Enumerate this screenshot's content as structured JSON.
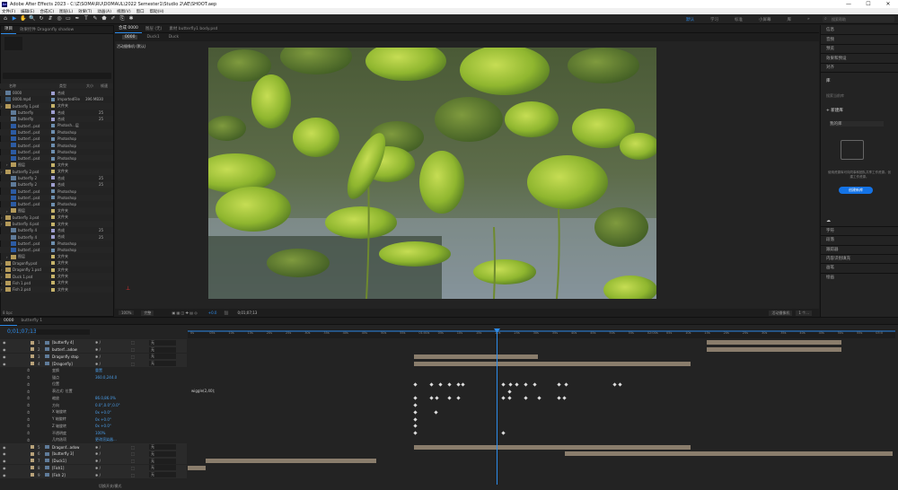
{
  "titlebar": {
    "logo": "Ae",
    "title": "Adobe After Effects 2023 - C:\\Z\\SOMA\\RU\\DOMAUL\\2022 Semester1\\Studio 2\\AE\\SHOOT.aep",
    "min": "—",
    "max": "☐",
    "close": "✕"
  },
  "menu": [
    "文件(F)",
    "编辑(E)",
    "合成(C)",
    "图层(L)",
    "效果(T)",
    "动画(A)",
    "视图(V)",
    "窗口",
    "帮助(H)"
  ],
  "tools": [
    "⌂",
    "▶",
    "✋",
    "🔍",
    "↻",
    "⇵",
    "◎",
    "▭",
    "✒",
    "T",
    "✎",
    "⬟",
    "✐",
    "⎘",
    "✱"
  ],
  "workspaces": {
    "items": [
      "默认",
      "学习",
      "标准",
      "小屏幕",
      "库"
    ],
    "active": 0,
    "more": "»"
  },
  "search_placeholder": "搜索帮助",
  "project": {
    "tabs": [
      "项目",
      "效果控件 Dragonfly shadow"
    ],
    "head": {
      "name": "名称",
      "type": "类型",
      "size": "大小",
      "fr": "帧速"
    },
    "rows": [
      {
        "name": "0000",
        "type": "合成",
        "sz": "",
        "fr": "",
        "k": "comp",
        "c": "#9e9ecf",
        "i": 0
      },
      {
        "name": "0000.mp4",
        "type": "ImportedFile",
        "sz": "396 MB",
        "fr": "30",
        "k": "file",
        "c": "#6d8eae",
        "i": 0
      },
      {
        "name": "butterfly 1.psd",
        "type": "文件夹",
        "sz": "",
        "fr": "",
        "k": "folder",
        "c": "#c5b26a",
        "i": 0
      },
      {
        "name": "butterfly",
        "type": "合成",
        "sz": "",
        "fr": "25",
        "k": "comp",
        "c": "#9e9ecf",
        "i": 1
      },
      {
        "name": "butterfly",
        "type": "合成",
        "sz": "",
        "fr": "25",
        "k": "comp",
        "c": "#9e9ecf",
        "i": 1
      },
      {
        "name": "butterf...psd",
        "type": "Photosh...层",
        "sz": "",
        "fr": "",
        "k": "psd",
        "c": "#6d8eae",
        "i": 1
      },
      {
        "name": "butterf...psd",
        "type": "Photoshop",
        "sz": "",
        "fr": "",
        "k": "psd",
        "c": "#6d8eae",
        "i": 1
      },
      {
        "name": "butterf...psd",
        "type": "Photoshop",
        "sz": "",
        "fr": "",
        "k": "psd",
        "c": "#6d8eae",
        "i": 1
      },
      {
        "name": "butterf...psd",
        "type": "Photoshop",
        "sz": "",
        "fr": "",
        "k": "psd",
        "c": "#6d8eae",
        "i": 1
      },
      {
        "name": "butterf...psd",
        "type": "Photoshop",
        "sz": "",
        "fr": "",
        "k": "psd",
        "c": "#6d8eae",
        "i": 1
      },
      {
        "name": "butterf...psd",
        "type": "Photoshop",
        "sz": "",
        "fr": "",
        "k": "psd",
        "c": "#6d8eae",
        "i": 1
      },
      {
        "name": "图层",
        "type": "文件夹",
        "sz": "",
        "fr": "",
        "k": "folder",
        "c": "#c5b26a",
        "i": 1
      },
      {
        "name": "butterfly 2.psd",
        "type": "文件夹",
        "sz": "",
        "fr": "",
        "k": "folder",
        "c": "#c5b26a",
        "i": 0
      },
      {
        "name": "butterfly 2",
        "type": "合成",
        "sz": "",
        "fr": "25",
        "k": "comp",
        "c": "#9e9ecf",
        "i": 1
      },
      {
        "name": "butterfly 2",
        "type": "合成",
        "sz": "",
        "fr": "25",
        "k": "comp",
        "c": "#9e9ecf",
        "i": 1
      },
      {
        "name": "butterf...psd",
        "type": "Photoshop",
        "sz": "",
        "fr": "",
        "k": "psd",
        "c": "#6d8eae",
        "i": 1
      },
      {
        "name": "butterf...psd",
        "type": "Photoshop",
        "sz": "",
        "fr": "",
        "k": "psd",
        "c": "#6d8eae",
        "i": 1
      },
      {
        "name": "butterf...psd",
        "type": "Photoshop",
        "sz": "",
        "fr": "",
        "k": "psd",
        "c": "#6d8eae",
        "i": 1
      },
      {
        "name": "图层",
        "type": "文件夹",
        "sz": "",
        "fr": "",
        "k": "folder",
        "c": "#c5b26a",
        "i": 1
      },
      {
        "name": "butterfly 3.psd",
        "type": "文件夹",
        "sz": "",
        "fr": "",
        "k": "folder",
        "c": "#c5b26a",
        "i": 0
      },
      {
        "name": "butterfly 4.psd",
        "type": "文件夹",
        "sz": "",
        "fr": "",
        "k": "folder",
        "c": "#c5b26a",
        "i": 0
      },
      {
        "name": "butterfly 4",
        "type": "合成",
        "sz": "",
        "fr": "25",
        "k": "comp",
        "c": "#9e9ecf",
        "i": 1
      },
      {
        "name": "butterfly 4",
        "type": "合成",
        "sz": "",
        "fr": "25",
        "k": "comp",
        "c": "#9e9ecf",
        "i": 1
      },
      {
        "name": "butterf...psd",
        "type": "Photoshop",
        "sz": "",
        "fr": "",
        "k": "psd",
        "c": "#6d8eae",
        "i": 1
      },
      {
        "name": "butterf...psd",
        "type": "Photoshop",
        "sz": "",
        "fr": "",
        "k": "psd",
        "c": "#6d8eae",
        "i": 1
      },
      {
        "name": "图层",
        "type": "文件夹",
        "sz": "",
        "fr": "",
        "k": "folder",
        "c": "#c5b26a",
        "i": 1
      },
      {
        "name": "Dragonfly.psd",
        "type": "文件夹",
        "sz": "",
        "fr": "",
        "k": "folder",
        "c": "#c5b26a",
        "i": 0
      },
      {
        "name": "Dragonfly 1.psd",
        "type": "文件夹",
        "sz": "",
        "fr": "",
        "k": "folder",
        "c": "#c5b26a",
        "i": 0
      },
      {
        "name": "Duck 1.psd",
        "type": "文件夹",
        "sz": "",
        "fr": "",
        "k": "folder",
        "c": "#c5b26a",
        "i": 0
      },
      {
        "name": "Fish 1.psd",
        "type": "文件夹",
        "sz": "",
        "fr": "",
        "k": "folder",
        "c": "#c5b26a",
        "i": 0
      },
      {
        "name": "Fish 2.psd",
        "type": "文件夹",
        "sz": "",
        "fr": "",
        "k": "folder",
        "c": "#c5b26a",
        "i": 0
      }
    ],
    "footer": "8 bpc"
  },
  "viewer": {
    "tabs": [
      "合成 0000",
      "图层 (无)",
      "素材 butterfly1 body.psd"
    ],
    "subtabs": [
      "0000",
      "Duck1",
      "Duck"
    ],
    "camera_label": "活动摄像机 (默认)",
    "zoom": "100%",
    "quality": "完整",
    "timecode": "0;01;07;13",
    "camera_menu": "活动摄像机",
    "view_menu": "1 个..."
  },
  "right_panel": {
    "items1": [
      "信息",
      "音频",
      "预览",
      "效果和预设",
      "对齐"
    ],
    "library": {
      "tab": "库",
      "search": "搜索当前库",
      "new_lib": "+ 新建库",
      "my_lib": "我的库",
      "msg": "使用资源库可向同事和团队共享工作资源。创建工作资源。",
      "btn": "创建新库"
    },
    "items2": [
      "字符",
      "段落",
      "跟踪器",
      "内容识别填充",
      "画笔",
      "绘画"
    ]
  },
  "timeline": {
    "tabs": [
      "0000",
      "butterfly 1"
    ],
    "timecode": "0;01;07;13",
    "cols": {
      "layer": "图层名称",
      "mode": "父级和链接"
    },
    "parent_none": "无",
    "ruler": [
      "0s",
      "05s",
      "10s",
      "15s",
      "20s",
      "25s",
      "30s",
      "35s",
      "40s",
      "45s",
      "50s",
      "55s",
      "01:00s",
      "05s",
      "10s",
      "15s",
      "20s",
      "25s",
      "30s",
      "35s",
      "40s",
      "45s",
      "50s",
      "55s",
      "02:00s",
      "05s",
      "10s",
      "15s",
      "20s",
      "25s",
      "30s",
      "35s",
      "40s",
      "45s",
      "50s",
      "55s",
      "03:0"
    ],
    "layers": [
      {
        "num": "1",
        "name": "[butterfly 4]",
        "fx": "/",
        "bar": [
          578,
          728
        ],
        "kind": "layer"
      },
      {
        "num": "2",
        "name": "butterf...adow",
        "fx": "/",
        "bar": [
          578,
          728
        ],
        "kind": "layer"
      },
      {
        "num": "3",
        "name": "Dragonfly stop",
        "fx": "/",
        "bar": [
          252,
          390
        ],
        "kind": "layer"
      },
      {
        "num": "4",
        "name": "[Dragonfly]",
        "fx": "/",
        "bar": [
          252,
          560
        ],
        "kind": "layer"
      },
      {
        "name": "变换",
        "sub": "重置",
        "kind": "prop"
      },
      {
        "name": "锚点",
        "val": "360.0,244.0",
        "kind": "prop"
      },
      {
        "name": "位置",
        "val": "",
        "kind": "prop"
      },
      {
        "name": "表达式: 位置",
        "val": "",
        "kind": "prop"
      },
      {
        "name": "缩放",
        "val": "86.0,86.0%",
        "kind": "prop"
      },
      {
        "name": "方向",
        "val": "0.0°,0.0°,0.0°",
        "kind": "prop"
      },
      {
        "name": "X 轴旋转",
        "val": "0x +0.0°",
        "kind": "prop"
      },
      {
        "name": "Y 轴旋转",
        "val": "0x +0.0°",
        "kind": "prop"
      },
      {
        "name": "Z 轴旋转",
        "val": "0x +0.0°",
        "kind": "prop"
      },
      {
        "name": "不透明度",
        "val": "100%",
        "kind": "prop"
      },
      {
        "name": "几何选项",
        "sub": "更改渲染器...",
        "kind": "prop"
      },
      {
        "num": "5",
        "name": "Dragonf...adow",
        "fx": "/",
        "bar": [
          252,
          560
        ],
        "kind": "layer"
      },
      {
        "num": "6",
        "name": "[butterfly 3]",
        "fx": "/",
        "bar": [
          420,
          785
        ],
        "kind": "layer"
      },
      {
        "num": "7",
        "name": "[Duck1]",
        "fx": "/",
        "bar": [
          20,
          210
        ],
        "kind": "layer"
      },
      {
        "num": "8",
        "name": "[Fish1]",
        "fx": "/",
        "bar": [
          0,
          20
        ],
        "kind": "layer"
      },
      {
        "num": "9",
        "name": "[Fish 2]",
        "fx": "/",
        "bar": [
          0,
          0
        ],
        "kind": "layer"
      }
    ],
    "expression": "wiggle(2,40);",
    "footer": "切换开关/模式"
  },
  "colors": {
    "accent": "#2d8ceb",
    "bar": "#8a7d6c"
  }
}
